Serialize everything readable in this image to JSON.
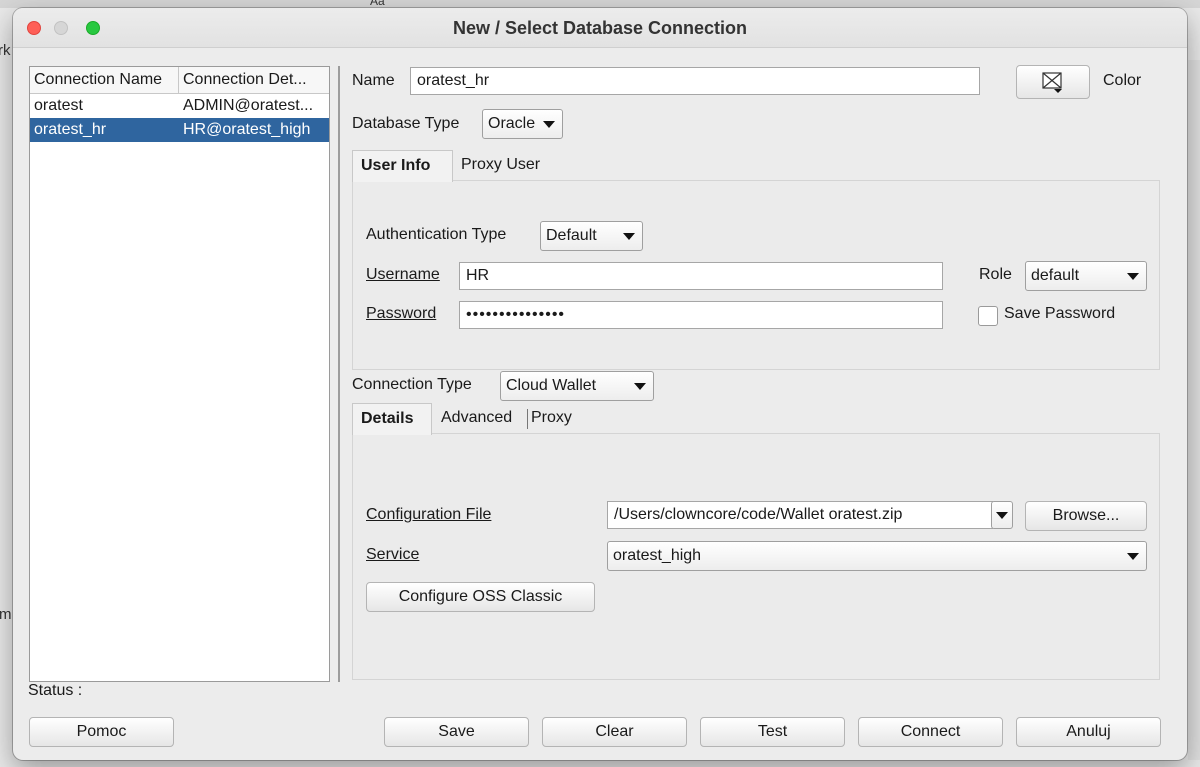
{
  "window": {
    "title": "New / Select Database Connection"
  },
  "connections": {
    "columns": [
      "Connection Name",
      "Connection Det..."
    ],
    "rows": [
      {
        "name": "oratest",
        "details": "ADMIN@oratest..."
      },
      {
        "name": "oratest_hr",
        "details": "HR@oratest_high",
        "selected": true
      }
    ]
  },
  "form": {
    "name_label": "Name",
    "name_value": "oratest_hr",
    "color_label": "Color",
    "db_type_label": "Database Type",
    "db_type_value": "Oracle",
    "tabs_user": [
      "User Info",
      "Proxy User"
    ],
    "auth_type_label": "Authentication Type",
    "auth_type_value": "Default",
    "username_label": "Username",
    "username_value": "HR",
    "role_label": "Role",
    "role_value": "default",
    "password_label": "Password",
    "password_value": "•••••••••••••••",
    "save_password_label": "Save Password",
    "save_password_checked": false,
    "conn_type_label": "Connection Type",
    "conn_type_value": "Cloud Wallet",
    "tabs_conn": [
      "Details",
      "Advanced",
      "Proxy"
    ],
    "config_file_label": "Configuration File",
    "config_file_value": "/Users/clowncore/code/Wallet oratest.zip",
    "browse_label": "Browse...",
    "service_label": "Service",
    "service_value": "oratest_high",
    "configure_oss_label": "Configure OSS Classic"
  },
  "status": {
    "label": "Status :"
  },
  "buttons": {
    "help": "Pomoc",
    "save": "Save",
    "clear": "Clear",
    "test": "Test",
    "connect": "Connect",
    "cancel": "Anuluj"
  },
  "background": {
    "glyph_a": "rk",
    "glyph_b": "m",
    "glyph_c": "Aa"
  }
}
